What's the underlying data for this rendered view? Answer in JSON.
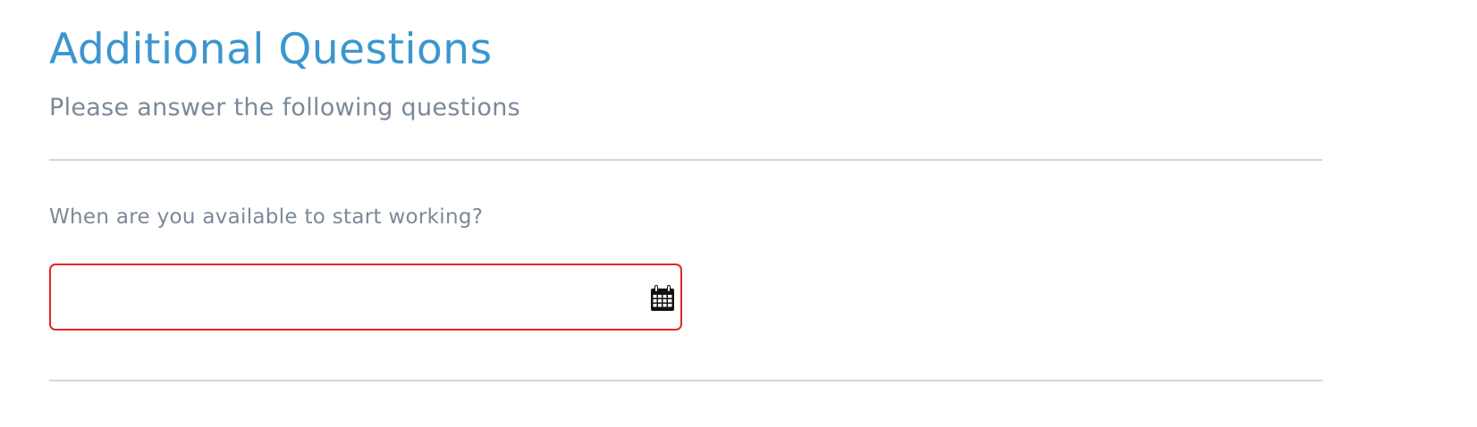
{
  "section": {
    "title": "Additional Questions",
    "subtitle": "Please answer the following questions"
  },
  "questions": [
    {
      "label": "When are you available to start working?",
      "input": {
        "value": "",
        "placeholder": "",
        "state": "error",
        "icon": "calendar-icon"
      }
    }
  ],
  "colors": {
    "title": "#3b96cf",
    "muted_text": "#7b8999",
    "error_border": "#e0262b",
    "divider": "#d4d7db"
  }
}
